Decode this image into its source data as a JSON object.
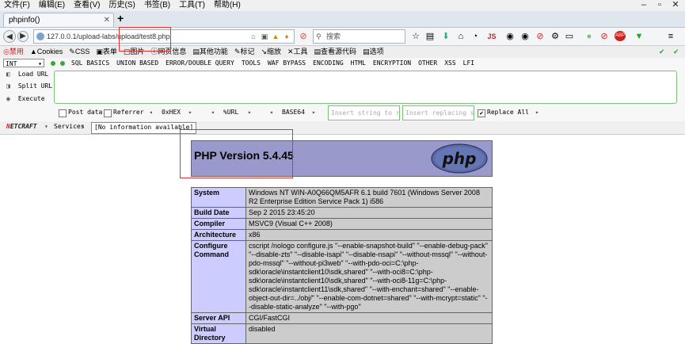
{
  "menubar": {
    "items": [
      "文件(F)",
      "编辑(E)",
      "查看(V)",
      "历史(S)",
      "书签(B)",
      "工具(T)",
      "帮助(H)"
    ]
  },
  "tab": {
    "title": "phpinfo()"
  },
  "nav": {
    "url": "127.0.0.1/upload-labs/upload/test8.php",
    "search_placeholder": "搜索"
  },
  "hackmenu": {
    "items": [
      "◎禁用",
      "▲Cookies",
      "✎CSS",
      "▣表单",
      "▢图片",
      "ⓘ网页信息",
      "▤其他功能",
      "✎标记",
      "↘缩放",
      "✕工具",
      "▤查看源代码",
      "▤选项"
    ]
  },
  "sqlbar": {
    "select": "INT",
    "items": [
      "SQL BASICS",
      "UNION BASED",
      "ERROR/DOUBLE QUERY",
      "TOOLS",
      "WAF BYPASS",
      "ENCODING",
      "HTML",
      "ENCRYPTION",
      "OTHER",
      "XSS",
      "LFI"
    ]
  },
  "hackbar": {
    "load_url": "Load URL",
    "split_url": "Split URL",
    "execute": "Execute",
    "post_data": "Post data",
    "referrer": "Referrer",
    "hex": "0xHEX",
    "url_enc": "%URL",
    "base64": "BASE64",
    "insert_placeholder": "Insert string to replace",
    "replacing_placeholder": "Insert replacing string",
    "replace_all": "Replace All"
  },
  "netcraft": {
    "logo_a": "N",
    "logo_b": "ETCRAFT",
    "services": "Services",
    "info": "[No information available]"
  },
  "php": {
    "version": "PHP Version 5.4.45",
    "logo_text": "php",
    "rows": [
      {
        "key": "System",
        "value": "Windows NT WIN-A0Q66QM5AFR 6.1 build 7601 (Windows Server 2008 R2 Enterprise Edition Service Pack 1) i586"
      },
      {
        "key": "Build Date",
        "value": "Sep 2 2015 23:45:20"
      },
      {
        "key": "Compiler",
        "value": "MSVC9 (Visual C++ 2008)"
      },
      {
        "key": "Architecture",
        "value": "x86"
      },
      {
        "key": "Configure Command",
        "value": "cscript /nologo configure.js \"--enable-snapshot-build\" \"--enable-debug-pack\" \"--disable-zts\" \"--disable-isapi\" \"--disable-nsapi\" \"--without-mssql\" \"--without-pdo-mssql\" \"--without-pi3web\" \"--with-pdo-oci=C:\\php-sdk\\oracle\\instantclient10\\sdk,shared\" \"--with-oci8=C:\\php-sdk\\oracle\\instantclient10\\sdk,shared\" \"--with-oci8-11g=C:\\php-sdk\\oracle\\instantclient11\\sdk,shared\" \"--with-enchant=shared\" \"--enable-object-out-dir=../obj/\" \"--enable-com-dotnet=shared\" \"--with-mcrypt=static\" \"--disable-static-analyze\" \"--with-pgo\""
      },
      {
        "key": "Server API",
        "value": "CGI/FastCGI"
      },
      {
        "key": "Virtual Directory",
        "value": "disabled"
      }
    ]
  },
  "colors": {
    "php_header_bg": "#9999cc",
    "table_key_bg": "#ccccff",
    "table_val_bg": "#cccccc",
    "highlight": "#e03030",
    "hackbar_green": "#7cc07c"
  }
}
